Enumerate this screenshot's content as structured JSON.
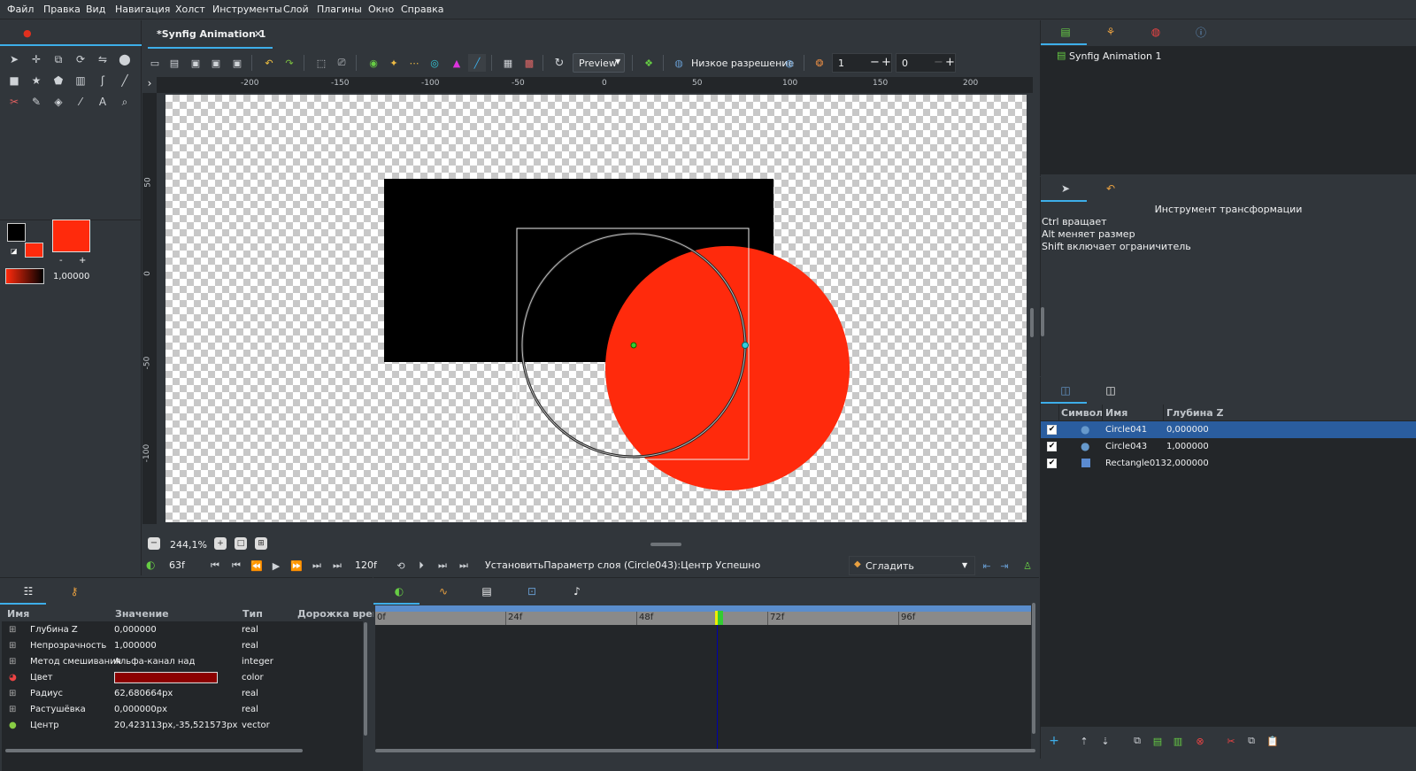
{
  "menu": [
    "Файл",
    "Правка",
    "Вид",
    "Навигация",
    "Холст",
    "Инструменты",
    "Слой",
    "Плагины",
    "Окно",
    "Справка"
  ],
  "document_tab": {
    "title": "*Synfig Animation 1",
    "close": "✕"
  },
  "toolbar": {
    "render_mode": "Preview",
    "resolution_label": "Низкое разрешение",
    "onion_past": "1",
    "onion_future": "0"
  },
  "ruler": {
    "h_ticks": [
      "-200",
      "-150",
      "-100",
      "-50",
      "0",
      "50",
      "100",
      "150",
      "200"
    ],
    "v_ticks": [
      "50",
      "0",
      "-50",
      "-100"
    ]
  },
  "fill_outline": {
    "width_value": "1,00000р",
    "minus": "-",
    "plus": "+"
  },
  "canvas_bottom": {
    "zoom": "244,1%"
  },
  "timebar": {
    "current_frame": "63f",
    "end_frame": "120f",
    "status": "УстановитьПараметр слоя (Circle043):Центр Успешно",
    "interpolation": "Сгладить"
  },
  "params": {
    "tabs": [
      "params-icon",
      "library-icon"
    ],
    "headers": {
      "name": "Имя",
      "value": "Значение",
      "type": "Тип",
      "track": "Дорожка врем"
    },
    "rows": [
      {
        "name": "Глубина Z",
        "value": "0,000000",
        "type": "real"
      },
      {
        "name": "Непрозрачность",
        "value": "1,000000",
        "type": "real"
      },
      {
        "name": "Метод смешивания",
        "value": "Альфа-канал над",
        "type": "integer"
      },
      {
        "name": "Цвет",
        "value": "",
        "type": "color"
      },
      {
        "name": "Радиус",
        "value": "62,680664px",
        "type": "real"
      },
      {
        "name": "Растушёвка",
        "value": "0,000000px",
        "type": "real"
      },
      {
        "name": "Центр",
        "value": "20,423113px,-35,521573px",
        "type": "vector"
      }
    ]
  },
  "timetrack": {
    "ticks": [
      "0f",
      "24f",
      "48f",
      "72f",
      "96f"
    ]
  },
  "canvas_browser": {
    "item": "Synfig Animation 1"
  },
  "tool_options": {
    "title": "Инструмент трансформации",
    "hints": [
      "Ctrl вращает",
      "Alt меняет размер",
      "Shift включает ограничитель"
    ]
  },
  "layers": {
    "headers": {
      "symbol": "Символ",
      "name": "Имя",
      "z": "Глубина Z"
    },
    "rows": [
      {
        "name": "Circle041",
        "z": "0,000000",
        "selected": true,
        "kind": "circle"
      },
      {
        "name": "Circle043",
        "z": "1,000000",
        "selected": false,
        "kind": "circle"
      },
      {
        "name": "Rectangle013",
        "z": "2,000000",
        "selected": false,
        "kind": "rectangle"
      }
    ]
  },
  "colors": {
    "accent": "#3daee9",
    "selection": "#2a5d9f",
    "red": "#ff2a0c",
    "dark_red": "#8b0000"
  }
}
